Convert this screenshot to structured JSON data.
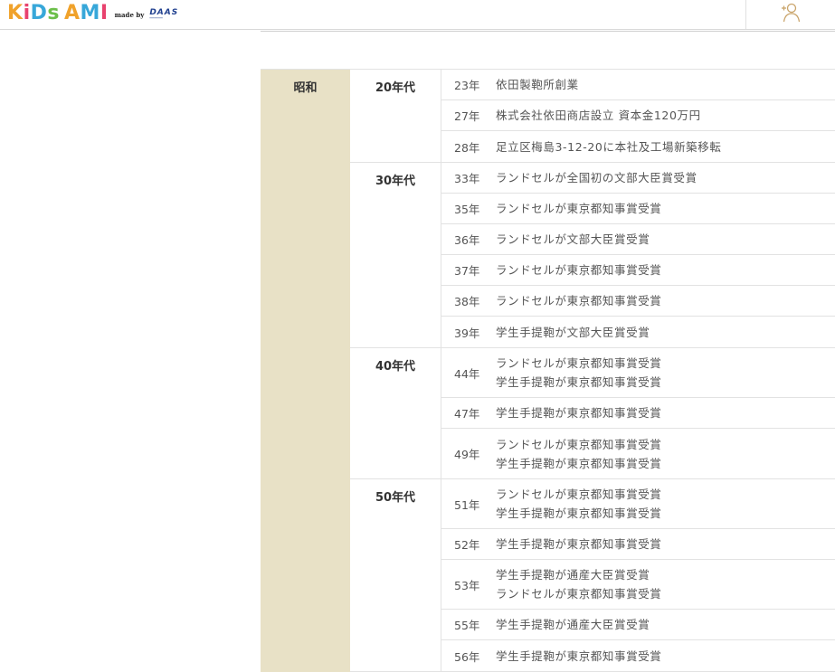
{
  "header": {
    "logo_letters": [
      {
        "char": "K",
        "color": "#f0a22b"
      },
      {
        "char": "i",
        "color": "#e8426e"
      },
      {
        "char": "D",
        "color": "#37a7d9"
      },
      {
        "char": "s",
        "color": "#6cbf4a"
      },
      {
        "char": " ",
        "color": "#ffffff"
      },
      {
        "char": "A",
        "color": "#f0a22b"
      },
      {
        "char": "M",
        "color": "#37a7d9"
      },
      {
        "char": "I",
        "color": "#e8426e"
      }
    ],
    "made_by": "made by",
    "company_mark": "DAAS",
    "account_icon": "add-user-icon",
    "accent_color": "#c9a46a"
  },
  "history": {
    "era": "昭和",
    "era_color": "#e8e1c6",
    "decades": [
      {
        "label": "20年代",
        "events": [
          {
            "year": "23年",
            "lines": [
              "依田製鞄所創業"
            ]
          },
          {
            "year": "27年",
            "lines": [
              "株式会社依田商店設立 資本金120万円"
            ]
          },
          {
            "year": "28年",
            "lines": [
              "足立区梅島3-12-20に本社及工場新築移転"
            ]
          }
        ]
      },
      {
        "label": "30年代",
        "events": [
          {
            "year": "33年",
            "lines": [
              "ランドセルが全国初の文部大臣賞受賞"
            ]
          },
          {
            "year": "35年",
            "lines": [
              "ランドセルが東京都知事賞受賞"
            ]
          },
          {
            "year": "36年",
            "lines": [
              "ランドセルが文部大臣賞受賞"
            ]
          },
          {
            "year": "37年",
            "lines": [
              "ランドセルが東京都知事賞受賞"
            ]
          },
          {
            "year": "38年",
            "lines": [
              "ランドセルが東京都知事賞受賞"
            ]
          },
          {
            "year": "39年",
            "lines": [
              "学生手提鞄が文部大臣賞受賞"
            ]
          }
        ]
      },
      {
        "label": "40年代",
        "events": [
          {
            "year": "44年",
            "lines": [
              "ランドセルが東京都知事賞受賞",
              "学生手提鞄が東京都知事賞受賞"
            ]
          },
          {
            "year": "47年",
            "lines": [
              "学生手提鞄が東京都知事賞受賞"
            ]
          },
          {
            "year": "49年",
            "lines": [
              "ランドセルが東京都知事賞受賞",
              "学生手提鞄が東京都知事賞受賞"
            ]
          }
        ]
      },
      {
        "label": "50年代",
        "events": [
          {
            "year": "51年",
            "lines": [
              "ランドセルが東京都知事賞受賞",
              "学生手提鞄が東京都知事賞受賞"
            ]
          },
          {
            "year": "52年",
            "lines": [
              "学生手提鞄が東京都知事賞受賞"
            ]
          },
          {
            "year": "53年",
            "lines": [
              "学生手提鞄が通産大臣賞受賞",
              "ランドセルが東京都知事賞受賞"
            ]
          },
          {
            "year": "55年",
            "lines": [
              "学生手提鞄が通産大臣賞受賞"
            ]
          },
          {
            "year": "56年",
            "lines": [
              "学生手提鞄が東京都知事賞受賞"
            ]
          }
        ]
      }
    ]
  }
}
